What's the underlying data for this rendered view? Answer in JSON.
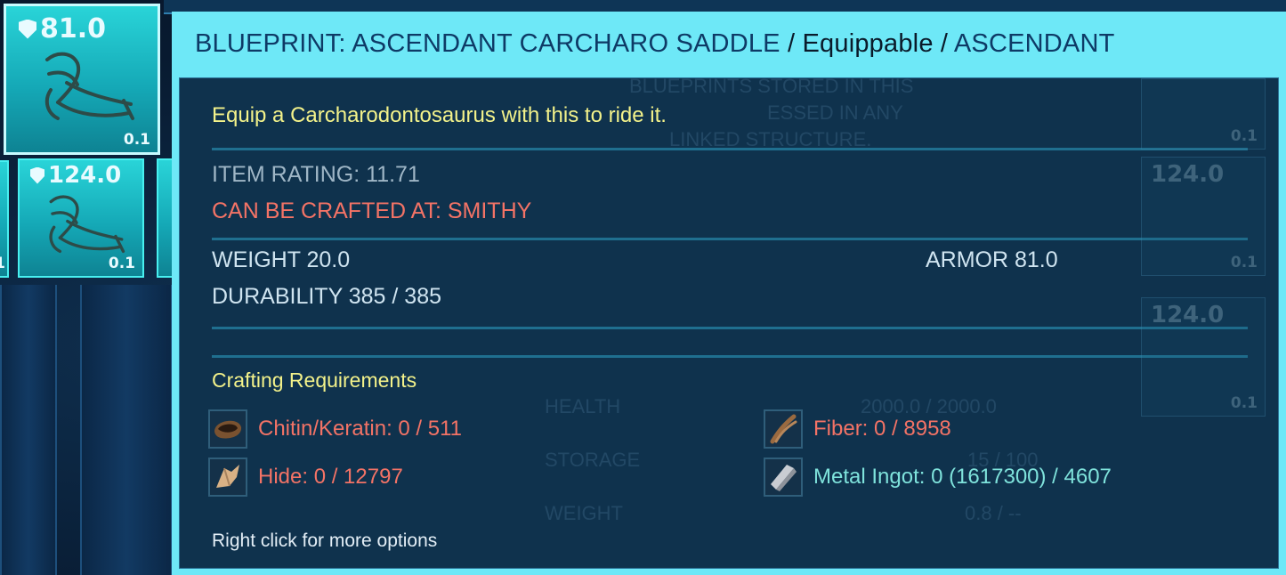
{
  "inventory": {
    "selected_slot": {
      "armor": "81.0",
      "weight": "0.1",
      "icon": "saddle-icon"
    },
    "second_slot": {
      "armor": "124.0",
      "weight": "0.1",
      "icon": "saddle-icon"
    },
    "partial_left_weight": "1",
    "partial_right_weights": [
      "0.1",
      "0.1",
      "0.1"
    ],
    "partial_right_armor": [
      "124.0",
      "124.0"
    ]
  },
  "tooltip": {
    "header": {
      "name": "BLUEPRINT: ASCENDANT CARCHARO SADDLE",
      "separator": "/",
      "type": "Equippable",
      "quality": "ASCENDANT"
    },
    "description": "Equip a Carcharodontosaurus with this to ride it.",
    "item_rating": "ITEM RATING: 11.71",
    "crafted_at": "CAN BE CRAFTED AT: SMITHY",
    "weight": "WEIGHT 20.0",
    "armor": "ARMOR 81.0",
    "durability": "DURABILITY 385 / 385",
    "crafting_title": "Crafting Requirements",
    "requirements": [
      {
        "icon": "chitin-icon",
        "label": "Chitin/Keratin: 0 / 511",
        "status": "insufficient"
      },
      {
        "icon": "fiber-icon",
        "label": "Fiber: 0 / 8958",
        "status": "insufficient"
      },
      {
        "icon": "hide-icon",
        "label": "Hide: 0 / 12797",
        "status": "insufficient"
      },
      {
        "icon": "metal-ingot-icon",
        "label": "Metal Ingot: 0 (1617300) / 4607",
        "status": "available"
      }
    ],
    "hint": "Right click for more options"
  },
  "background_ghost_text": {
    "blueprint_note": [
      "BLUEPRINTS STORED IN THIS",
      "ESSED IN ANY",
      "LINKED STRUCTURE."
    ],
    "stats": [
      {
        "label": "HEALTH",
        "value": "2000.0 / 2000.0"
      },
      {
        "label": "STORAGE",
        "value": "15 / 100"
      },
      {
        "label": "WEIGHT",
        "value": "0.8 / --"
      }
    ]
  },
  "colors": {
    "tooltip_frame": "#6ee8f7",
    "header_text": "#0e3a66",
    "description_yellow": "#f3f28a",
    "insufficient_red": "#f37366",
    "available_cyan": "#7fe3dc",
    "stat_grey": "#9fb6c6"
  }
}
